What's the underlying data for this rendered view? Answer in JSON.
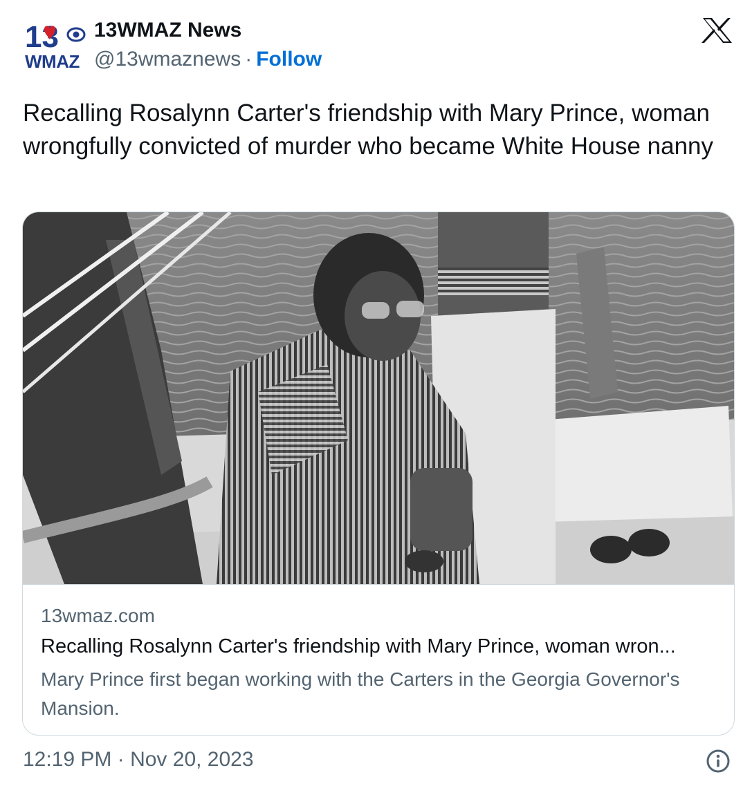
{
  "author": {
    "logo_text_top": "13",
    "logo_text_bottom": "WMAZ",
    "name": "13WMAZ News",
    "handle": "@13wmaznews",
    "separator": "·",
    "follow_label": "Follow"
  },
  "tweet": {
    "text": "Recalling Rosalynn Carter's friendship with Mary Prince, woman wrongfully convicted of murder who became White House nanny"
  },
  "card": {
    "image_icon": "photo-woman-on-boat",
    "domain": "13wmaz.com",
    "title": "Recalling Rosalynn Carter's friendship with Mary Prince, woman wron...",
    "description": "Mary Prince first began working with the Carters in the Georgia Governor's Mansion."
  },
  "footer": {
    "timestamp": "12:19 PM · Nov 20, 2023",
    "info_icon": "info-icon"
  },
  "colors": {
    "text": "#0f1419",
    "secondary": "#536471",
    "link": "#006fd6",
    "border": "#cfd9de",
    "logo_blue": "#1f3d8c",
    "logo_red": "#d8202a"
  }
}
